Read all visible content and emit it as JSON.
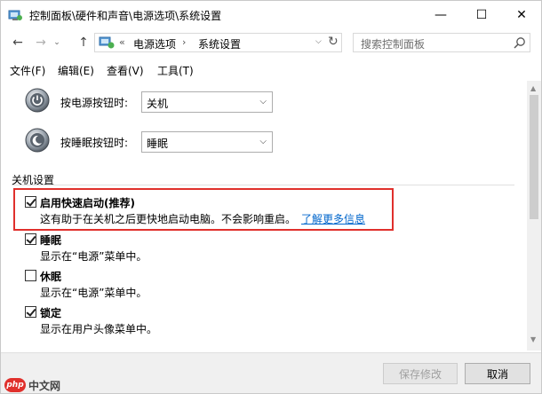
{
  "window": {
    "title": "控制面板\\硬件和声音\\电源选项\\系统设置",
    "controls": {
      "minimize": "—",
      "maximize": "☐",
      "close": "✕"
    }
  },
  "address": {
    "chevron": "«",
    "crumb1": "电源选项",
    "separator": "›",
    "crumb2": "系统设置",
    "dropdown": "⌵",
    "refresh": "↻"
  },
  "search": {
    "placeholder": "搜索控制面板"
  },
  "menu": {
    "file": "文件(F)",
    "edit": "编辑(E)",
    "view": "查看(V)",
    "tools": "工具(T)"
  },
  "power_buttons": {
    "power_label": "按电源按钮时:",
    "power_value": "关机",
    "sleep_label": "按睡眠按钮时:",
    "sleep_value": "睡眠"
  },
  "shutdown": {
    "title": "关机设置",
    "items": [
      {
        "label": "启用快速启动(推荐)",
        "checked": true,
        "desc": "这有助于在关机之后更快地启动电脑。不会影响重启。",
        "link": "了解更多信息"
      },
      {
        "label": "睡眠",
        "checked": true,
        "desc": "显示在“电源”菜单中。"
      },
      {
        "label": "休眠",
        "checked": false,
        "desc": "显示在“电源”菜单中。"
      },
      {
        "label": "锁定",
        "checked": true,
        "desc": "显示在用户头像菜单中。"
      }
    ]
  },
  "footer": {
    "save": "保存修改",
    "cancel": "取消"
  },
  "watermark": {
    "logo": "php",
    "text": "中文网"
  },
  "colors": {
    "highlight": "#e0302c",
    "link": "#0066cc"
  }
}
